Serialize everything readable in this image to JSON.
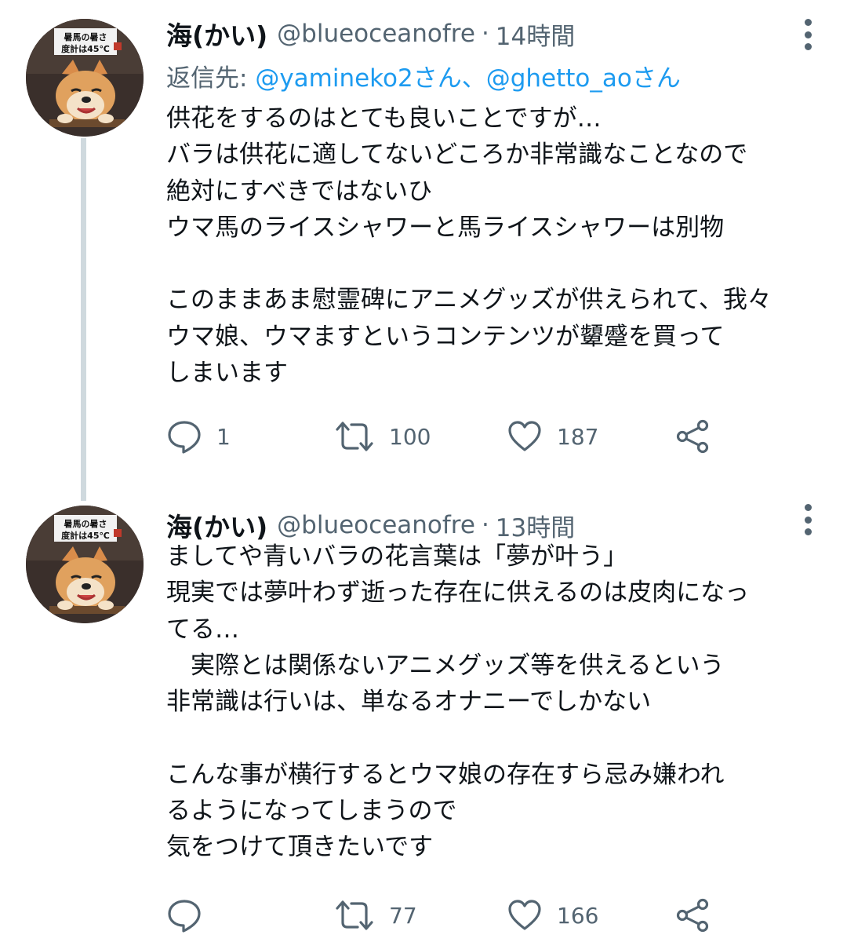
{
  "tweets": [
    {
      "display_name": "海(かい)",
      "handle": "@blueoceanofre",
      "time": "14時間",
      "reply_label": "返信先: ",
      "reply_mentions": "@yamineko2さん、@ghetto_aoさん",
      "lines": [
        "供花をするのはとても良いことですが…",
        "バラは供花に適してないどころか非常識なことなので",
        "絶対にすべきではないひ",
        "ウマ馬のライスシャワーと馬ライスシャワーは別物",
        "",
        "このままあま慰霊碑にアニメグッズが供えられて、我々",
        "ウマ娘、ウマますというコンテンツが顰蹙を買って",
        "しまいます"
      ],
      "replies": "1",
      "retweets": "100",
      "likes": "187",
      "avatar_text": [
        "暑馬の暑さ",
        "度計は45℃"
      ]
    },
    {
      "display_name": "海(かい)",
      "handle": "@blueoceanofre",
      "time": "13時間",
      "lines": [
        "ましてや青いバラの花言葉は「夢が叶う」",
        "現実では夢叶わず逝った存在に供えるのは皮肉になっ",
        "てる…",
        "　実際とは関係ないアニメグッズ等を供えるという",
        "非常識は行いは、単なるオナニーでしかない",
        "",
        "こんな事が横行するとウマ娘の存在すら忌み嫌われ",
        "るようになってしまうので",
        "気をつけて頂きたいです"
      ],
      "replies": "",
      "retweets": "77",
      "likes": "166",
      "avatar_text": [
        "暑馬の暑さ",
        "度計は45℃"
      ]
    }
  ],
  "icons": {
    "reply": "speech-bubble-icon",
    "retweet": "retweet-arrows-icon",
    "like": "heart-icon",
    "share": "share-icon",
    "more": "vertical-ellipsis-icon"
  },
  "colors": {
    "text": "#0f1419",
    "secondary": "#536471",
    "mention": "#1d9bf0",
    "thread_line": "#cfd9de"
  }
}
